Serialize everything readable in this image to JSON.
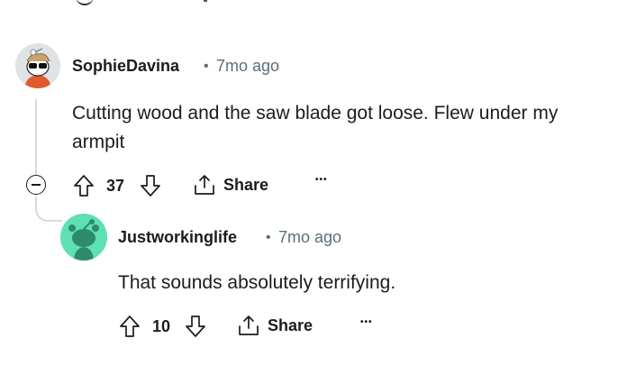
{
  "comments": [
    {
      "username": "SophieDavina",
      "separator": "•",
      "time": "7mo ago",
      "body": "Cutting wood and the saw blade got loose. Flew under my armpit",
      "votes": "37",
      "share_label": "Share",
      "more_label": "•••"
    },
    {
      "username": "Justworkinglife",
      "separator": "•",
      "time": "7mo ago",
      "body": "That sounds absolutely terrifying.",
      "votes": "10",
      "share_label": "Share",
      "more_label": "•••"
    }
  ],
  "colors": {
    "reply_avatar_bg": "#5fe0b4",
    "thread_line": "#d7dadc",
    "meta_text": "#576f76"
  }
}
